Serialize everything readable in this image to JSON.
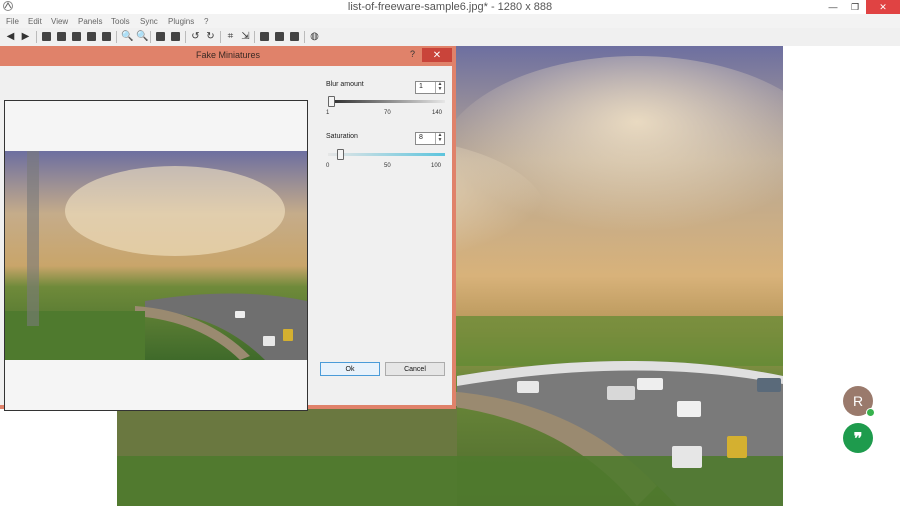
{
  "window": {
    "title": "list-of-freeware-sample6.jpg*  - 1280 x 888"
  },
  "menu": [
    "File",
    "Edit",
    "View",
    "Panels",
    "Tools",
    "Sync",
    "Plugins",
    "?"
  ],
  "dialog": {
    "title": "Fake Miniatures",
    "help": "?",
    "close": "✕",
    "blur": {
      "label": "Blur amount",
      "value": "1",
      "ticks": [
        "1",
        "70",
        "140"
      ],
      "level": 0.0
    },
    "saturation": {
      "label": "Saturation",
      "value": "8",
      "ticks": [
        "0",
        "50",
        "100"
      ],
      "level": 0.08
    },
    "ok_label": "Ok",
    "cancel_label": "Cancel"
  },
  "chat": {
    "avatar_initial": "R",
    "hangouts_glyph": "❞"
  },
  "colors": {
    "dialog_border": "#e0826a",
    "close_red": "#c9443a",
    "accent_blue": "#4a9bd8",
    "hangouts_green": "#1e9b4d"
  }
}
